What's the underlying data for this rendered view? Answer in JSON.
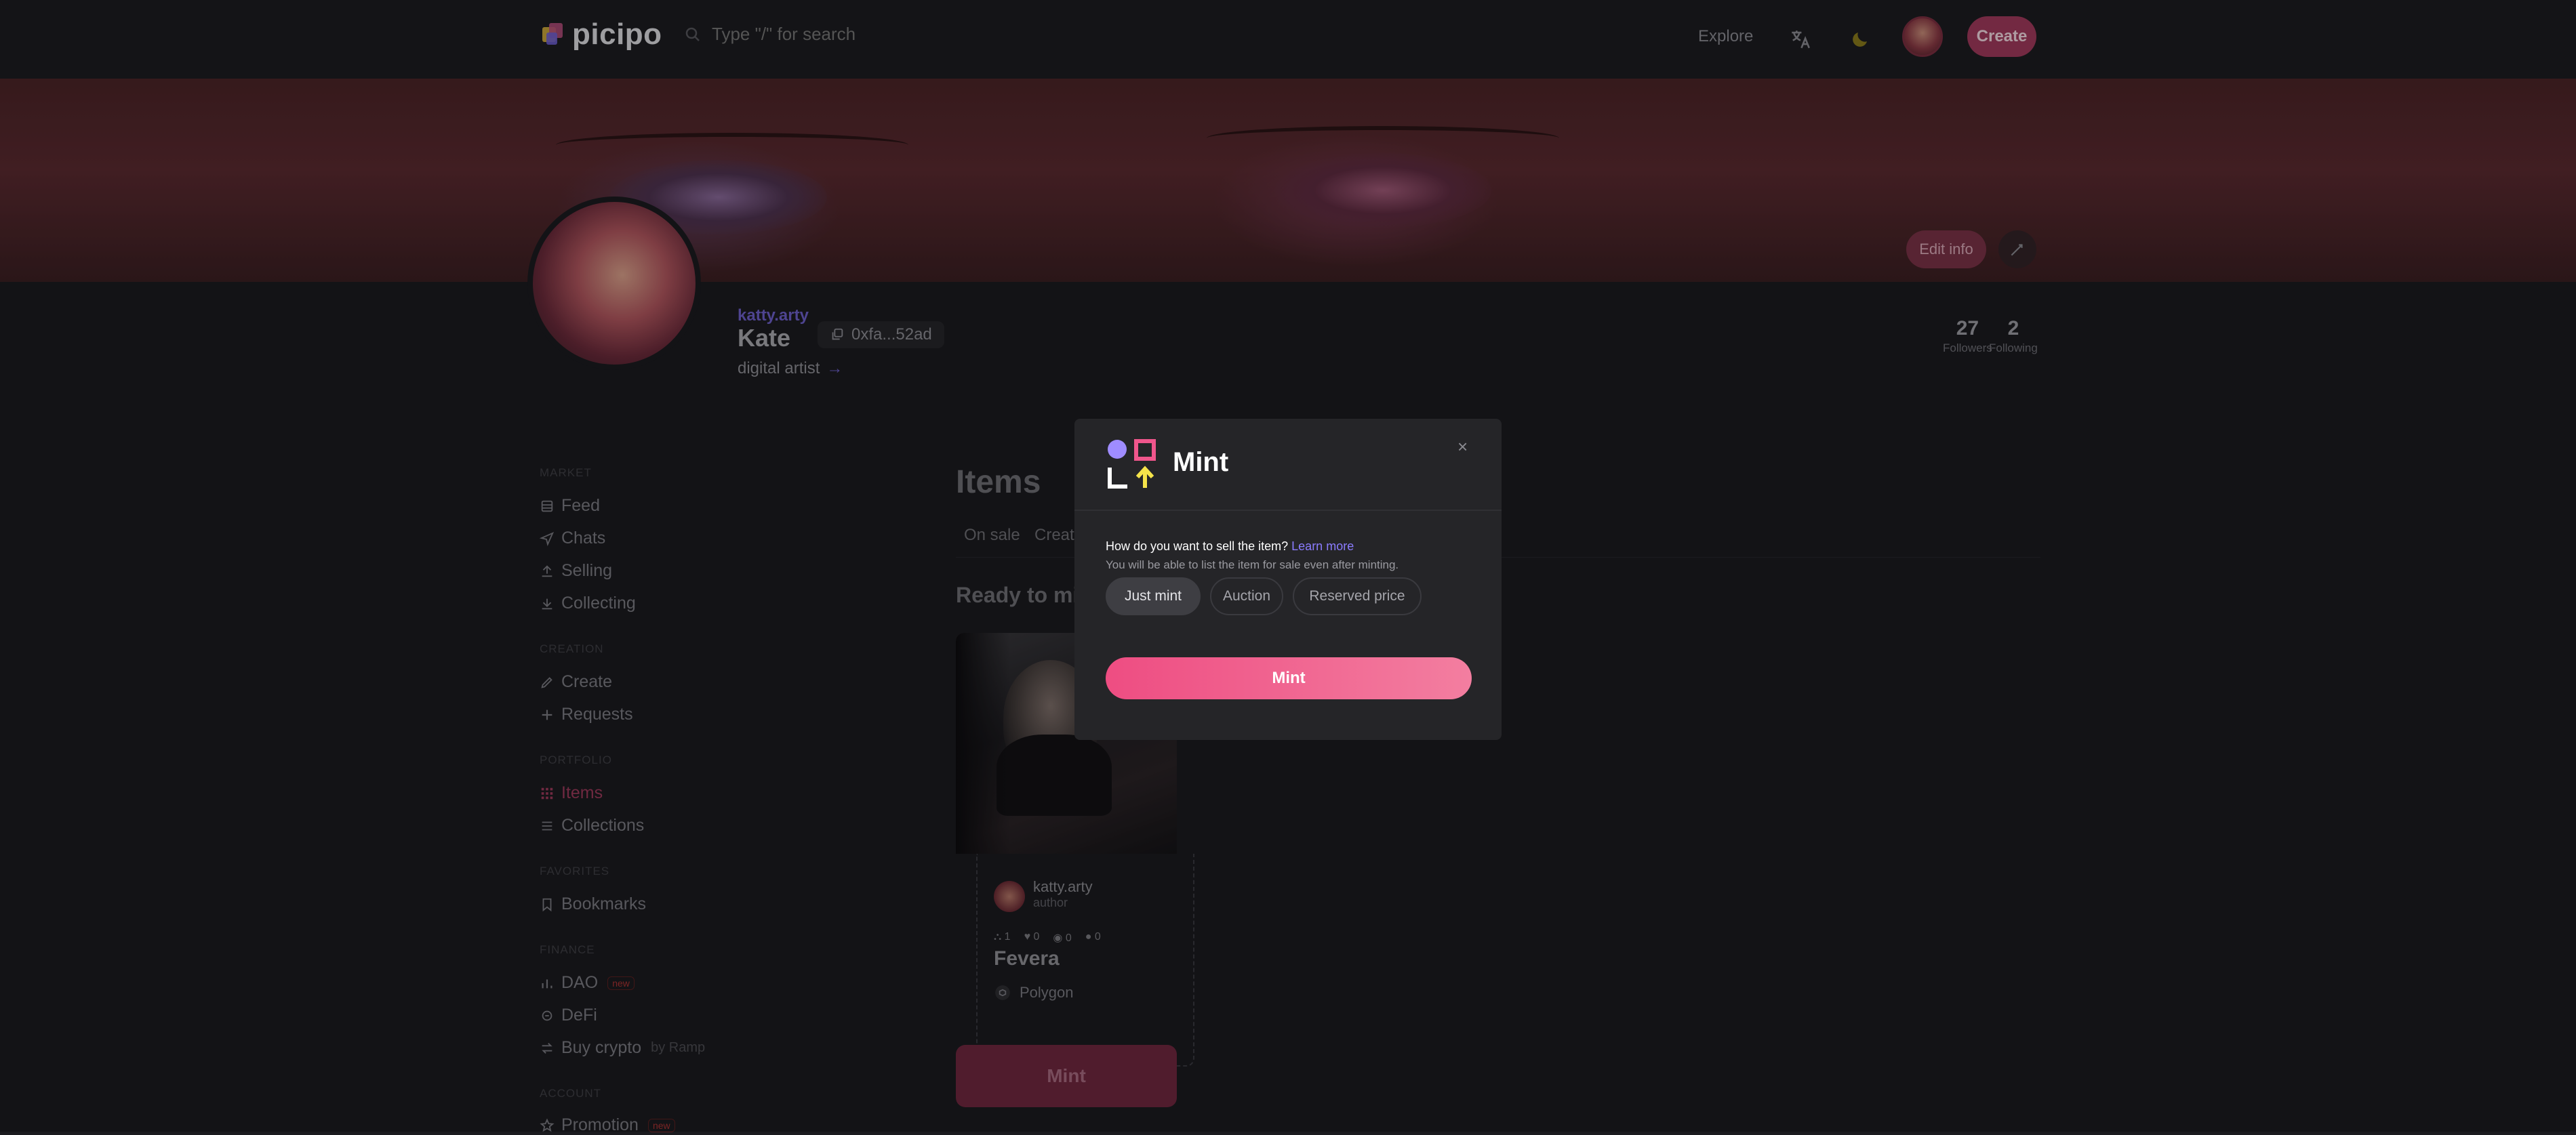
{
  "header": {
    "brand": "picipo",
    "search_placeholder": "Type \"/\" for search",
    "explore": "Explore",
    "create": "Create"
  },
  "banner": {
    "edit_info": "Edit info"
  },
  "profile": {
    "handle": "katty.arty",
    "name": "Kate",
    "address": "0xfa...52ad",
    "bio": "digital artist",
    "followers": {
      "value": "27",
      "label": "Followers"
    },
    "following": {
      "value": "2",
      "label": "Following"
    }
  },
  "sidebar": {
    "sections": [
      {
        "title": "MARKET",
        "items": [
          "Feed",
          "Chats",
          "Selling",
          "Collecting"
        ]
      },
      {
        "title": "CREATION",
        "items": [
          "Create",
          "Requests"
        ]
      },
      {
        "title": "PORTFOLIO",
        "items": [
          "Items",
          "Collections"
        ]
      },
      {
        "title": "FAVORITES",
        "items": [
          "Bookmarks"
        ]
      },
      {
        "title": "FINANCE",
        "items": [
          "DAO",
          "DeFi",
          "Buy crypto"
        ]
      },
      {
        "title": "ACCOUNT",
        "items": [
          "Promotion"
        ]
      }
    ],
    "new_badge": "new",
    "buy_crypto_by": "by Ramp"
  },
  "main": {
    "heading": "Items",
    "tabs": [
      "On sale",
      "Creat"
    ],
    "section": "Ready to mi",
    "card": {
      "author": "katty.arty",
      "role": "author",
      "stats": [
        "1",
        "0",
        "0",
        "0"
      ],
      "title": "Fevera",
      "chain": "Polygon",
      "mint_button": "Mint"
    }
  },
  "modal": {
    "title": "Mint",
    "close": "×",
    "question": "How do you want to sell the item?",
    "learn_more": "Learn more",
    "note": "You will be able to list the item for sale even after minting.",
    "options": [
      "Just mint",
      "Auction",
      "Reserved price"
    ],
    "selected_option": "Just mint",
    "mint_button": "Mint"
  },
  "colors": {
    "accent": "#ee4d82",
    "link": "#8b7cff",
    "bg": "#1b1b1f"
  }
}
